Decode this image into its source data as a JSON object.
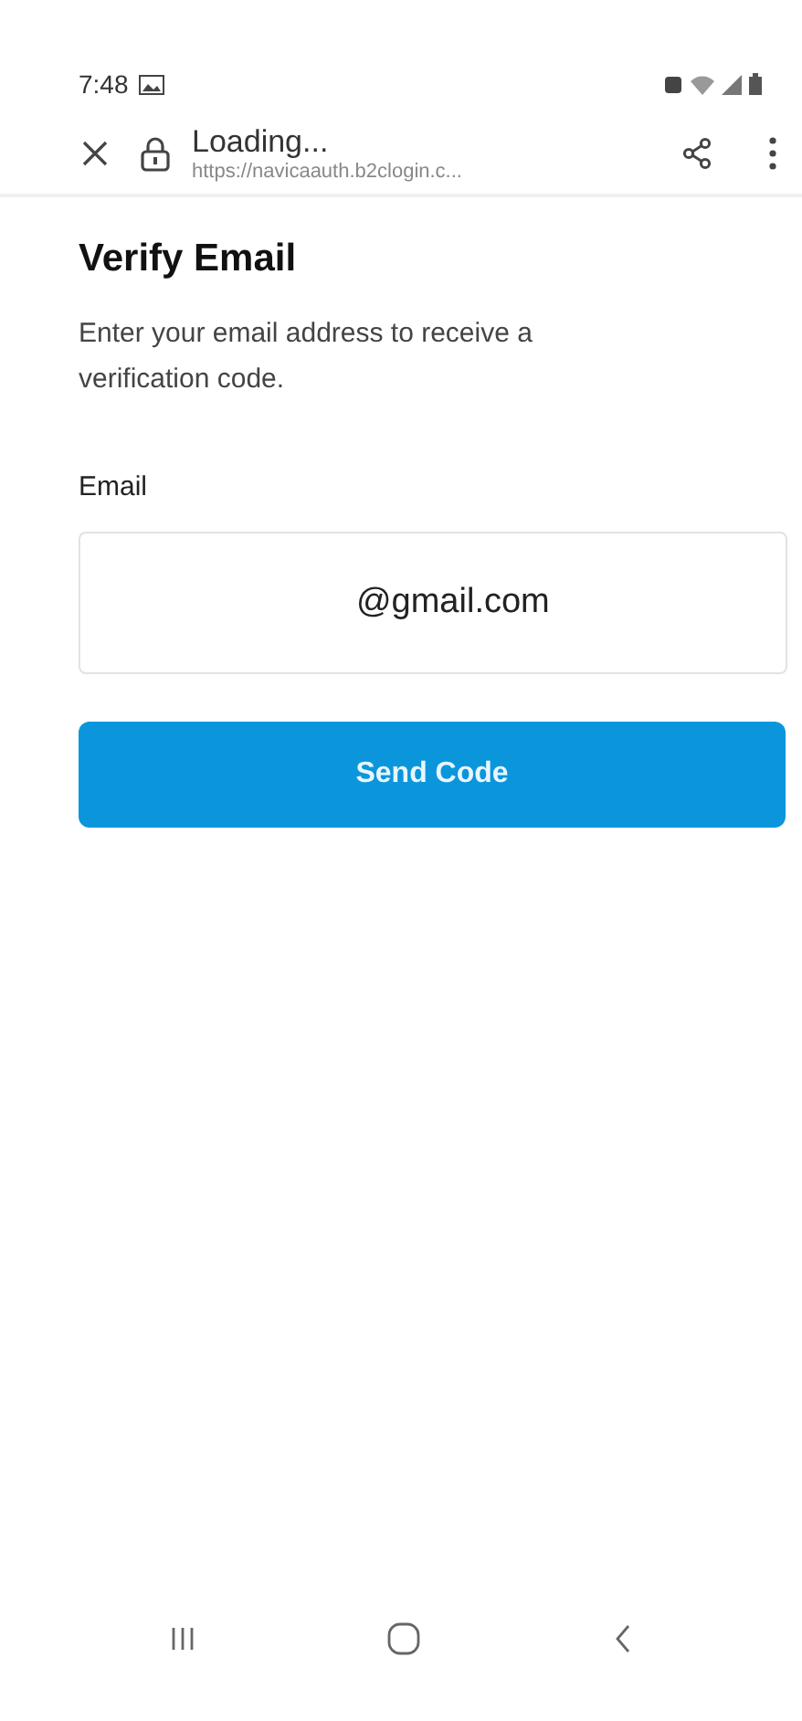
{
  "status_bar": {
    "time": "7:48"
  },
  "browser_bar": {
    "title": "Loading...",
    "url": "https://navicaauth.b2clogin.c..."
  },
  "form": {
    "title": "Verify Email",
    "description": "Enter your email address to receive a verification code.",
    "email_label": "Email",
    "email_value": "@gmail.com",
    "button": "Send Code"
  }
}
